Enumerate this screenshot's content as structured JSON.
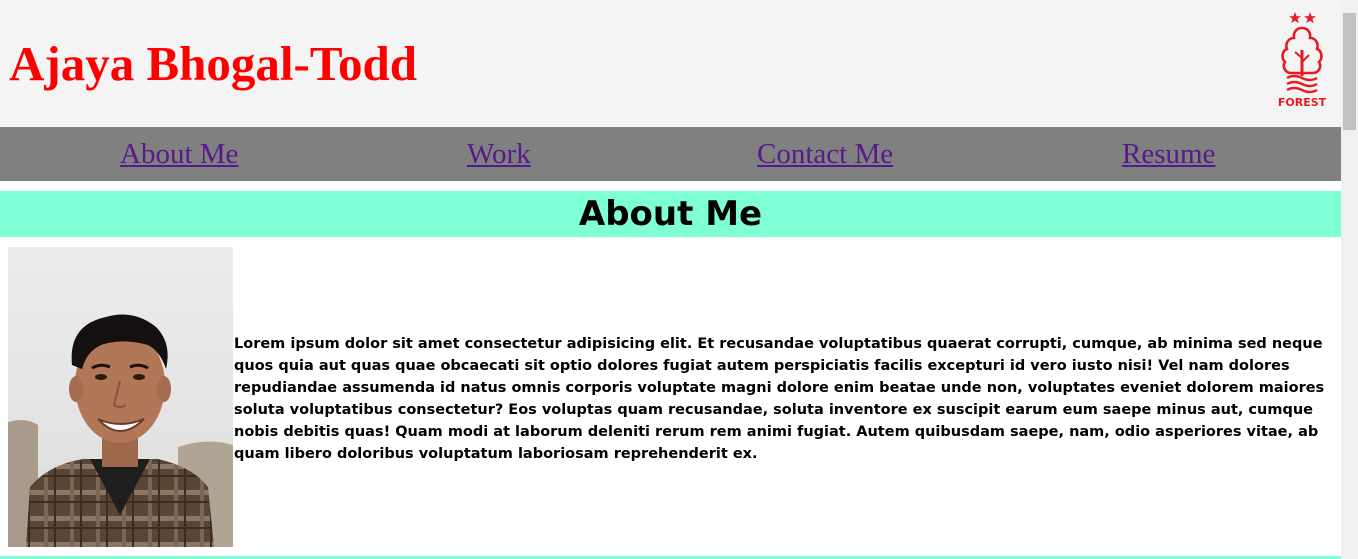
{
  "header": {
    "title": "Ajaya Bhogal-Todd",
    "logo": {
      "icon": "nottingham-forest-crest-icon",
      "text": "FOREST",
      "color": "#e51c23"
    }
  },
  "nav": {
    "links": [
      {
        "label": "About Me"
      },
      {
        "label": "Work"
      },
      {
        "label": "Contact Me"
      },
      {
        "label": "Resume"
      }
    ]
  },
  "about": {
    "heading": "About Me",
    "portrait_icon": "profile-photo",
    "body": "Lorem ipsum dolor sit amet consectetur adipisicing elit. Et recusandae voluptatibus quaerat corrupti, cumque, ab minima sed neque quos quia aut quas quae obcaecati sit optio dolores fugiat autem perspiciatis facilis excepturi id vero iusto nisi! Vel nam dolores repudiandae assumenda id natus omnis corporis voluptate magni dolore enim beatae unde non, voluptates eveniet dolorem maiores soluta voluptatibus consectetur? Eos voluptas quam recusandae, soluta inventore ex suscipit earum eum saepe minus aut, cumque nobis debitis quas! Quam modi at laborum deleniti rerum rem animi fugiat. Autem quibusdam saepe, nam, odio asperiores vitae, ab quam libero doloribus voluptatum laboriosam reprehenderit ex."
  },
  "colors": {
    "title": "#ff0000",
    "header_bg": "#f4f4f4",
    "nav_bg": "#808080",
    "link": "#551a8b",
    "heading_bg": "#7fffd4"
  }
}
